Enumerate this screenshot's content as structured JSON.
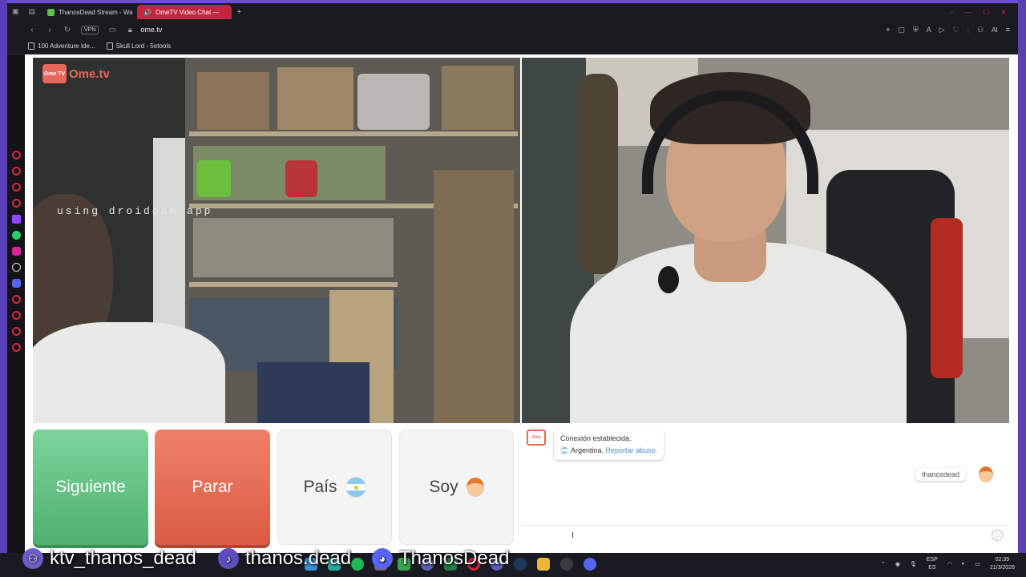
{
  "browser": {
    "tabs": [
      {
        "label": "ThanosDead Stream - Wa",
        "favicon_color": "#5fbf4f"
      },
      {
        "label": "OmeTV Video Chat —",
        "favicon_color": "#ffffff",
        "active": true
      }
    ],
    "new_tab_icon": "plus-icon",
    "address": {
      "vpn_label": "VPN",
      "url": "ome.tv"
    },
    "ai_label": "AI",
    "bookmarks": [
      {
        "label": "100 Adventure Ide..."
      },
      {
        "label": "Skull Lord - 5etools"
      }
    ],
    "accent_color": "#c0273e"
  },
  "omegle": {
    "logo_badge": "Ome TV",
    "logo_text": "Ome.tv",
    "stranger_watermark": "using droidcam.app",
    "buttons": {
      "next": "Siguiente",
      "stop": "Parar",
      "country": "País",
      "me": "Soy"
    },
    "colors": {
      "next": "#5fbf7d",
      "stop": "#e66a50",
      "brand": "#e7675b"
    }
  },
  "chat": {
    "system_line1": "Conexión establecida.",
    "system_country": "Argentina.",
    "system_report_link": "Reportar abuso.",
    "user_message": "thanosdead"
  },
  "overlay": {
    "kick": "ktv_thanos_dead",
    "tiktok": "thanos.dead",
    "discord": "ThanosDead"
  },
  "taskbar": {
    "lang_top": "ESP",
    "lang_bottom": "ES",
    "time": "02:39",
    "date": "21/3/2026"
  }
}
